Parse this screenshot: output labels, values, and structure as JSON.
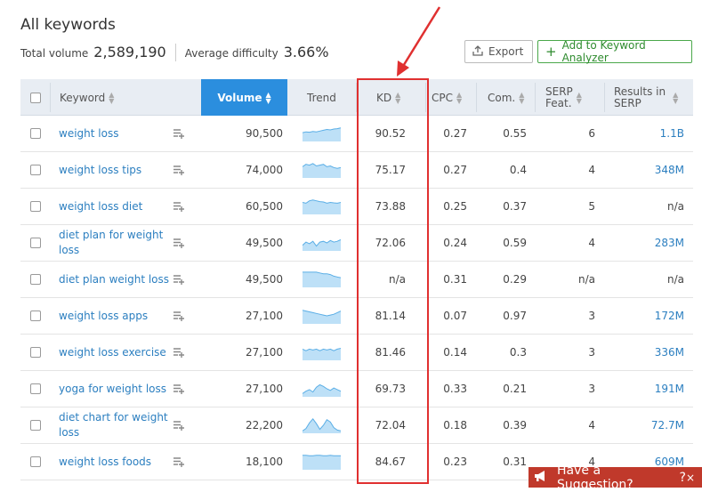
{
  "page": {
    "title": "All keywords",
    "total_volume_label": "Total volume",
    "total_volume": "2,589,190",
    "avg_difficulty_label": "Average difficulty",
    "avg_difficulty": "3.66%"
  },
  "toolbar": {
    "export_label": "Export",
    "add_label": "Add to Keyword Analyzer"
  },
  "table": {
    "headers": {
      "keyword": "Keyword",
      "volume": "Volume",
      "trend": "Trend",
      "kd": "KD",
      "cpc": "CPC",
      "com": "Com.",
      "serp1": "SERP",
      "serp2": "Feat.",
      "results1": "Results in",
      "results2": "SERP"
    },
    "rows": [
      {
        "keyword": "weight loss",
        "volume": "90,500",
        "kd": "90.52",
        "cpc": "0.27",
        "com": "0.55",
        "serp": "6",
        "results": "1.1B",
        "trend": [
          0.55,
          0.6,
          0.58,
          0.62,
          0.6,
          0.65,
          0.7,
          0.75,
          0.72,
          0.78,
          0.8,
          0.85
        ]
      },
      {
        "keyword": "weight loss tips",
        "volume": "74,000",
        "kd": "75.17",
        "cpc": "0.27",
        "com": "0.4",
        "serp": "4",
        "results": "348M",
        "trend": [
          0.7,
          0.85,
          0.8,
          0.9,
          0.75,
          0.8,
          0.85,
          0.7,
          0.75,
          0.65,
          0.6,
          0.65
        ]
      },
      {
        "keyword": "weight loss diet",
        "volume": "60,500",
        "kd": "73.88",
        "cpc": "0.25",
        "com": "0.37",
        "serp": "5",
        "results": "n/a",
        "trend": [
          0.75,
          0.7,
          0.85,
          0.9,
          0.85,
          0.8,
          0.78,
          0.7,
          0.75,
          0.72,
          0.7,
          0.75
        ]
      },
      {
        "keyword": "diet plan for weight loss",
        "volume": "49,500",
        "kd": "72.06",
        "cpc": "0.24",
        "com": "0.59",
        "serp": "4",
        "results": "283M",
        "trend": [
          0.35,
          0.55,
          0.45,
          0.6,
          0.3,
          0.55,
          0.6,
          0.5,
          0.65,
          0.55,
          0.6,
          0.7
        ]
      },
      {
        "keyword": "diet plan weight loss",
        "volume": "49,500",
        "kd": "n/a",
        "cpc": "0.31",
        "com": "0.29",
        "serp": "n/a",
        "results": "n/a",
        "trend": [
          0.95,
          0.95,
          0.95,
          0.95,
          0.95,
          0.9,
          0.85,
          0.85,
          0.8,
          0.7,
          0.65,
          0.6
        ]
      },
      {
        "keyword": "weight loss apps",
        "volume": "27,100",
        "kd": "81.14",
        "cpc": "0.07",
        "com": "0.97",
        "serp": "3",
        "results": "172M",
        "trend": [
          0.85,
          0.8,
          0.75,
          0.7,
          0.65,
          0.6,
          0.55,
          0.5,
          0.55,
          0.6,
          0.7,
          0.8
        ]
      },
      {
        "keyword": "weight loss exercise",
        "volume": "27,100",
        "kd": "81.46",
        "cpc": "0.14",
        "com": "0.3",
        "serp": "3",
        "results": "336M",
        "trend": [
          0.7,
          0.6,
          0.7,
          0.65,
          0.7,
          0.6,
          0.7,
          0.65,
          0.7,
          0.6,
          0.7,
          0.75
        ]
      },
      {
        "keyword": "yoga for weight loss",
        "volume": "27,100",
        "kd": "69.73",
        "cpc": "0.33",
        "com": "0.21",
        "serp": "3",
        "results": "191M",
        "trend": [
          0.2,
          0.35,
          0.45,
          0.3,
          0.6,
          0.75,
          0.65,
          0.5,
          0.4,
          0.55,
          0.45,
          0.35
        ]
      },
      {
        "keyword": "diet chart for weight loss",
        "volume": "22,200",
        "kd": "72.04",
        "cpc": "0.18",
        "com": "0.39",
        "serp": "4",
        "results": "72.7M",
        "trend": [
          0.15,
          0.3,
          0.65,
          0.9,
          0.6,
          0.25,
          0.5,
          0.85,
          0.7,
          0.35,
          0.2,
          0.15
        ]
      },
      {
        "keyword": "weight loss foods",
        "volume": "18,100",
        "kd": "84.67",
        "cpc": "0.23",
        "com": "0.31",
        "serp": "4",
        "results": "609M",
        "trend": [
          0.9,
          0.9,
          0.88,
          0.88,
          0.9,
          0.9,
          0.88,
          0.88,
          0.9,
          0.88,
          0.88,
          0.88
        ]
      }
    ]
  },
  "suggestion": {
    "label": "Have a Suggestion?",
    "help_glyph": "?",
    "close_glyph": "×"
  },
  "colors": {
    "accent": "#2b8ede",
    "highlight": "#e03030",
    "link": "#2c7fc0",
    "trend_fill": "#bde0f7",
    "trend_line": "#5aaee6"
  }
}
